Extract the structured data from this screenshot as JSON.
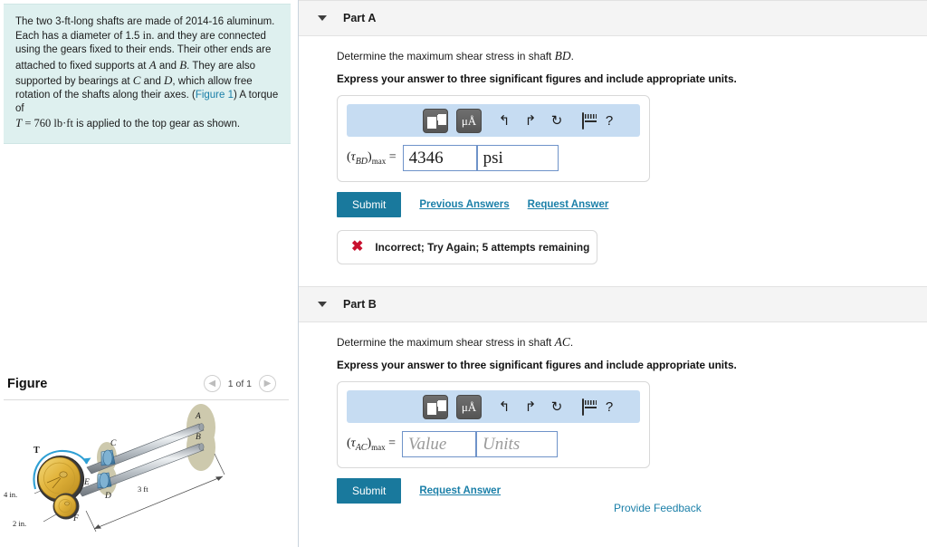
{
  "left": {
    "question": {
      "line1_a": "The two 3-ft-long shafts are made of 2014-16 aluminum.",
      "line2_a": "Each has a diameter of 1.5 ",
      "line2_in": "in.",
      "line2_b": " and they are connected",
      "line3": "using the gears fixed to their ends. Their other ends are",
      "line4_a": "attached to fixed supports at ",
      "line4_A": "A",
      "line4_b": " and ",
      "line4_B": "B",
      "line4_c": ". They are also",
      "line5_a": "supported by bearings at ",
      "line5_C": "C",
      "line5_b": " and ",
      "line5_D": "D",
      "line5_c": ", which allow free",
      "line6_a": "rotation of the shafts along their axes. (",
      "line6_link": "Figure 1",
      "line6_b": ") A torque of",
      "line7_T": "T",
      "line7_eq": " = 760 ",
      "line7_units": "lb·ft",
      "line7_rest": " is applied to the top gear as shown."
    },
    "figure": {
      "title": "Figure",
      "prev_icon": "chevron-left-icon",
      "count": "1 of 1",
      "next_icon": "chevron-right-icon",
      "diagram": {
        "label_A": "A",
        "label_B": "B",
        "label_C": "C",
        "label_D": "D",
        "label_E": "E",
        "label_F": "F",
        "label_T": "T",
        "dim_length": "3 ft",
        "dim_gear_big": "4 in.",
        "dim_gear_small": "2 in."
      }
    }
  },
  "parts": [
    {
      "id": "a",
      "header": "Part A",
      "caret_icon": "caret-down-icon",
      "prompt_pre": "Determine the maximum shear stress in shaft ",
      "prompt_math": "BD",
      "prompt_post": ".",
      "instruction": "Express your answer to three significant figures and include appropriate units.",
      "toolbar": {
        "template_icon": "math-template-icon",
        "units_icon": "micro-angstrom-units-icon",
        "units_label": "μÅ",
        "undo_icon": "undo-icon",
        "redo_icon": "redo-icon",
        "reset_icon": "reset-icon",
        "keyboard_icon": "keyboard-icon",
        "help_icon": "help-icon",
        "help_label": "?"
      },
      "lhs_open": "(",
      "lhs_tau": "τ",
      "lhs_sub": "BD",
      "lhs_close": ")",
      "lhs_max": "max",
      "lhs_eq": "=",
      "value": "4346",
      "value_placeholder": "Value",
      "units": "psi",
      "units_placeholder": "Units",
      "submit_label": "Submit",
      "links": [
        "Previous Answers",
        "Request Answer"
      ],
      "feedback": {
        "icon": "error-x-icon",
        "text": "Incorrect; Try Again; 5 attempts remaining"
      }
    },
    {
      "id": "b",
      "header": "Part B",
      "caret_icon": "caret-down-icon",
      "prompt_pre": "Determine the maximum shear stress in shaft ",
      "prompt_math": "AC",
      "prompt_post": ".",
      "instruction": "Express your answer to three significant figures and include appropriate units.",
      "toolbar": {
        "template_icon": "math-template-icon",
        "units_icon": "micro-angstrom-units-icon",
        "units_label": "μÅ",
        "undo_icon": "undo-icon",
        "redo_icon": "redo-icon",
        "reset_icon": "reset-icon",
        "keyboard_icon": "keyboard-icon",
        "help_icon": "help-icon",
        "help_label": "?"
      },
      "lhs_open": "(",
      "lhs_tau": "τ",
      "lhs_sub": "AC",
      "lhs_close": ")",
      "lhs_max": "max",
      "lhs_eq": "=",
      "value": "",
      "value_placeholder": "Value",
      "units": "",
      "units_placeholder": "Units",
      "submit_label": "Submit",
      "links": [
        "Request Answer"
      ],
      "feedback": null
    }
  ],
  "footer": {
    "provide_feedback": "Provide Feedback"
  },
  "colors": {
    "question_bg": "#def0ef",
    "part_header_bg": "#f4f4f4",
    "mathbar_bg": "#c6dcf2",
    "submit": "#19799d",
    "link": "#1a7fa8",
    "error": "#c8102e",
    "input_border": "#6f93c9"
  }
}
